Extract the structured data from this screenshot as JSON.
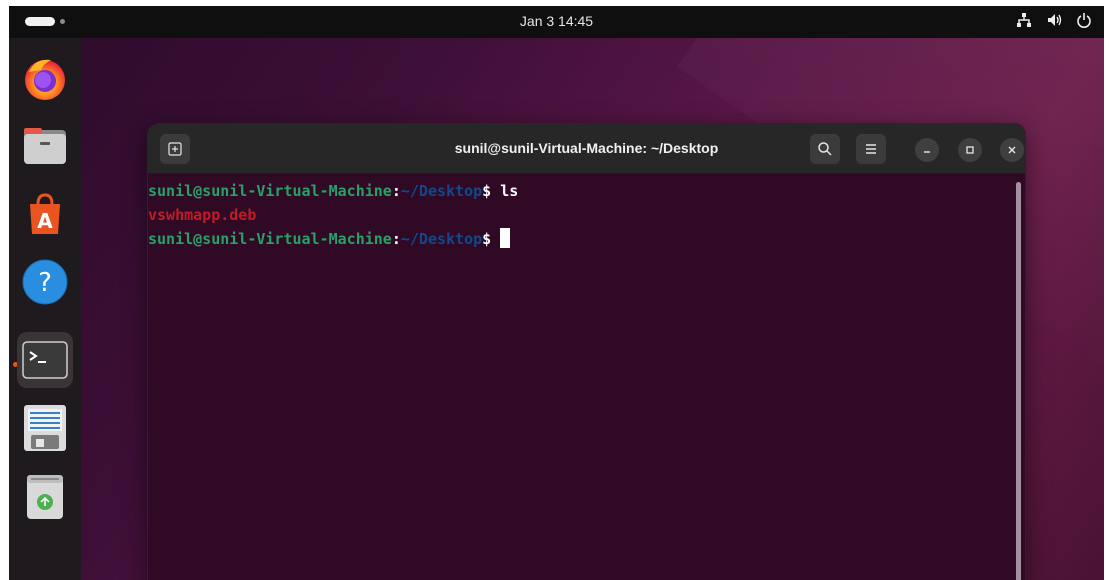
{
  "topbar": {
    "clock": "Jan 3  14:45",
    "tray_icons": [
      "network-icon",
      "volume-icon",
      "power-icon"
    ]
  },
  "dock": {
    "items": [
      {
        "name": "firefox",
        "icon": "firefox-icon",
        "active": false
      },
      {
        "name": "files",
        "icon": "files-icon",
        "active": false
      },
      {
        "name": "app-center",
        "icon": "app-center-icon",
        "active": false
      },
      {
        "name": "help",
        "icon": "help-icon",
        "active": false
      },
      {
        "name": "terminal",
        "icon": "terminal-icon",
        "active": true
      },
      {
        "name": "text-editor",
        "icon": "text-editor-icon",
        "active": false
      },
      {
        "name": "trash",
        "icon": "trash-icon",
        "active": false
      }
    ]
  },
  "terminal": {
    "title": "sunil@sunil-Virtual-Machine: ~/Desktop",
    "lines": [
      {
        "user": "sunil@sunil-Virtual-Machine",
        "sep": ":",
        "path": "~/Desktop",
        "prompt": "$ ",
        "command": "ls"
      },
      {
        "output": "vswhmapp.deb"
      },
      {
        "user": "sunil@sunil-Virtual-Machine",
        "sep": ":",
        "path": "~/Desktop",
        "prompt": "$ ",
        "command": ""
      }
    ]
  },
  "colors": {
    "accent": "#e95420",
    "terminal_bg": "#300a24",
    "prompt_user": "#26a269",
    "prompt_path": "#12488b",
    "deb_file": "#c01c28"
  }
}
